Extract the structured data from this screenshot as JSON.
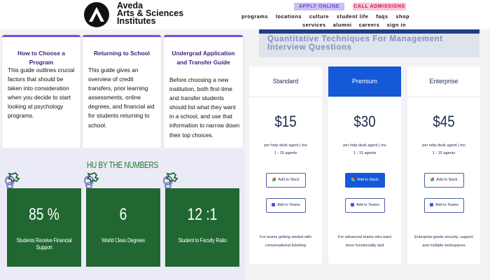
{
  "header": {
    "brand_lines": [
      "Aveda",
      "Arts & Sciences",
      "Institutes"
    ],
    "apply_button": "APPLY ONLINE",
    "call_button": "CALL ADMISSIONS",
    "nav_primary": [
      "programs",
      "locations",
      "culture",
      "student life",
      "faqs",
      "shop"
    ],
    "nav_secondary": [
      "services",
      "alumni",
      "careers",
      "sign in"
    ]
  },
  "guides": [
    {
      "title": "How to Choose a Program",
      "text": "This guide outlines crucial factors that should be taken into consideration when you decide to start looking at psychology programs."
    },
    {
      "title": "Returning to School",
      "text": "This guide gives an overview of credit transfers, prior learning assessments, online degrees, and financial aid for students returning to school."
    },
    {
      "title": "Undergrad Application and Transfer Guide",
      "text": "Before choosing a new institution, both first-time and transfer students should list what they want in a school, and use that information to narrow down their top choices."
    }
  ],
  "numbers": {
    "title": "HU BY THE NUMBERS",
    "stats": [
      {
        "value": "85 %",
        "label": "Students Receive Financial Support"
      },
      {
        "value": "6",
        "label": "World Class Degrees"
      },
      {
        "value": "12 :1",
        "label": "Student to Faculty Ratio"
      }
    ]
  },
  "banner": {
    "text": "Quantitative Techniques For Management Interview Questions"
  },
  "pricing": {
    "plans": [
      {
        "name": "Standard",
        "price": "$15",
        "unit": "per help desk agent | mo",
        "range": "1 - 15 agents",
        "slack": "Add to Slack",
        "teams": "Add to Teams",
        "desc": "For teams getting started with conversational ticketing"
      },
      {
        "name": "Premium",
        "price": "$30",
        "unit": "per help desk agent | mo",
        "range": "1 - 15 agents",
        "slack": "Add to Slack",
        "teams": "Add to Teams",
        "desc": "For advanced teams who want more functionality and"
      },
      {
        "name": "Enterprise",
        "price": "$45",
        "unit": "per help desk agent | mo",
        "range": "1 - 15 agents",
        "slack": "Add to Slack",
        "teams": "Add to Teams",
        "desc": "Enterprise-grade security, support and multiple workspaces"
      }
    ]
  },
  "colors": {
    "apply_bg": "#c9c2ec",
    "call_bg": "#f6c9d6",
    "stat_green": "#216732",
    "premium_blue": "#1558d8",
    "guide_title": "#3e1f7a"
  },
  "icons": [
    "logo-mark",
    "flower-icon",
    "slack-icon",
    "teams-icon"
  ]
}
